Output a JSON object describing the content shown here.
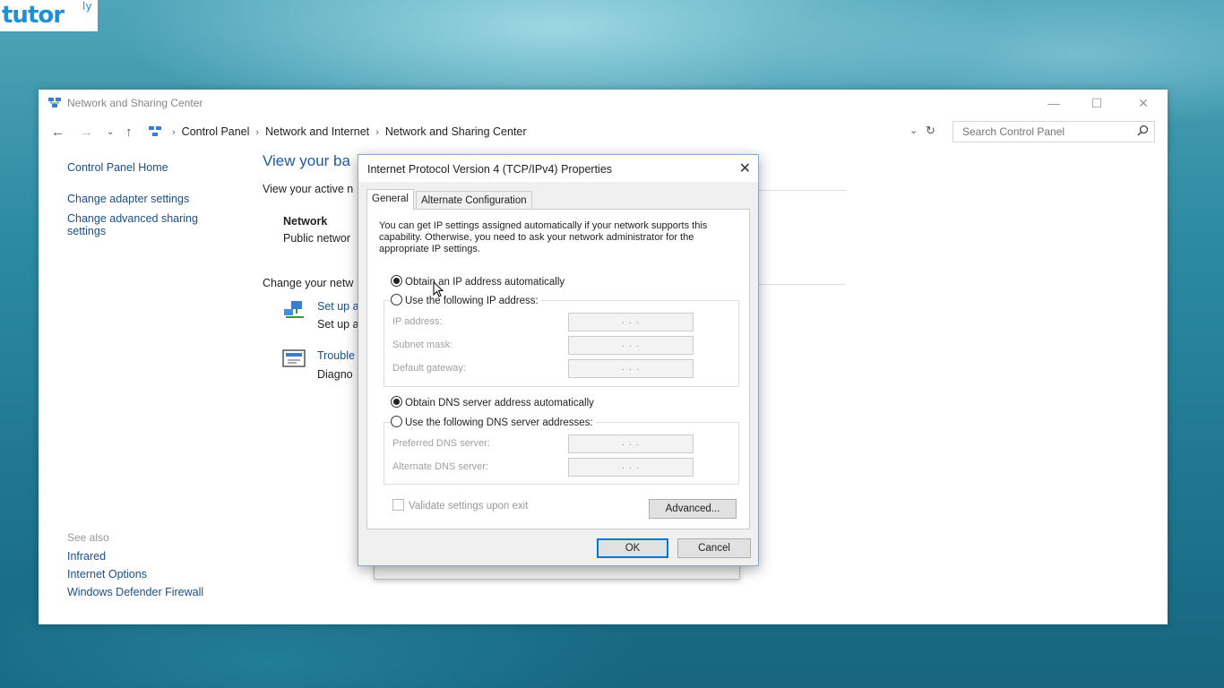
{
  "logo": {
    "text": "tutor",
    "sup": "ly"
  },
  "window": {
    "title": "Network and Sharing Center",
    "controls": {
      "minimize": "—",
      "maximize": "☐",
      "close": "✕"
    }
  },
  "address": {
    "crumbs": [
      "Control Panel",
      "Network and Internet",
      "Network and Sharing Center"
    ],
    "search_placeholder": "Search Control Panel"
  },
  "sidebar": {
    "items": [
      "Control Panel Home",
      "Change adapter settings",
      "Change advanced sharing settings"
    ],
    "see_also_title": "See also",
    "see_also": [
      "Infrared",
      "Internet Options",
      "Windows Defender Firewall"
    ]
  },
  "main": {
    "heading": "View your ba",
    "active_label": "View your active n",
    "network_name": "Network",
    "network_type": "Public networ",
    "change_label": "Change your netw",
    "setup_link": "Set up a",
    "setup_desc": "Set up a",
    "trouble_link": "Trouble",
    "trouble_desc": "Diagno"
  },
  "dialog": {
    "title": "Internet Protocol Version 4 (TCP/IPv4) Properties",
    "close": "✕",
    "tabs": [
      "General",
      "Alternate Configuration"
    ],
    "description": "You can get IP settings assigned automatically if your network supports this capability. Otherwise, you need to ask your network administrator for the appropriate IP settings.",
    "ip_auto": "Obtain an IP address automatically",
    "ip_manual": "Use the following IP address:",
    "ip_address": "IP address:",
    "subnet_mask": "Subnet mask:",
    "default_gateway": "Default gateway:",
    "dns_auto": "Obtain DNS server address automatically",
    "dns_manual": "Use the following DNS server addresses:",
    "preferred_dns": "Preferred DNS server:",
    "alternate_dns": "Alternate DNS server:",
    "ip_placeholder": ".       .       .",
    "validate": "Validate settings upon exit",
    "advanced": "Advanced...",
    "ok": "OK",
    "cancel": "Cancel"
  }
}
